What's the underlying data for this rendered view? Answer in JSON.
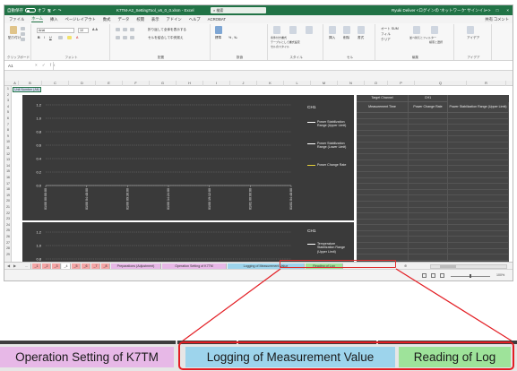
{
  "window": {
    "autosave_label": "自動保存",
    "autosave_state": "オフ",
    "title": "K7TM-A2_SettingTool_v6_0_0.xlsm - Excel",
    "search_placeholder": "検索",
    "user": "Ryuki Deliver <ログインの 'ネットワーク' サインイン >",
    "minimize": "—",
    "maximize": "□",
    "close": "×"
  },
  "menu": {
    "items": [
      "ファイル",
      "ホーム",
      "挿入",
      "ページレイアウト",
      "数式",
      "データ",
      "校閲",
      "表示",
      "アドイン",
      "ヘルプ",
      "ACROBAT"
    ],
    "share": "共有",
    "comments": "コメント"
  },
  "ribbon": {
    "paste": "貼り付け",
    "clipboard": "クリップボード",
    "font_name": "Arial",
    "font_size": "10",
    "font": "フォント",
    "alignment": "配置",
    "wrap": "折り返して全体を表示する",
    "merge": "セルを結合して中央揃え",
    "number_format": "標準",
    "number": "数値",
    "conditional": "条件付き書式",
    "table": "テーブルとして書式設定",
    "cell_styles": "セルのスタイル",
    "styles": "スタイル",
    "insert": "挿入",
    "delete": "削除",
    "format": "書式",
    "cells": "セル",
    "autosum": "オート SUM",
    "fill": "フィル",
    "clear": "クリア",
    "sort": "並べ替えとフィルター",
    "find": "検索と選択",
    "editing": "編集",
    "ideas": "アイデア",
    "ideas_group": "アイデア"
  },
  "formula_bar": {
    "name_box": "A1",
    "fx": "fx",
    "value": ""
  },
  "columns": [
    "A",
    "B",
    "C",
    "D",
    "E",
    "F",
    "G",
    "H",
    "I",
    "J",
    "K",
    "L",
    "M",
    "N",
    "O",
    "P",
    "Q",
    "R",
    "S"
  ],
  "rows": [
    "1",
    "2",
    "3",
    "4",
    "5",
    "6",
    "7",
    "8",
    "9",
    "10",
    "11",
    "12",
    "13",
    "14",
    "15",
    "16",
    "17",
    "18",
    "19",
    "20",
    "21",
    "22",
    "23",
    "24",
    "25",
    "26",
    "27",
    "28",
    "29"
  ],
  "unit_cell": "Unit Number (Alt)",
  "charts": [
    {
      "title": "CH1",
      "legend": [
        {
          "label": "Power Stabilization Range (Upper Limit)",
          "color": "#ffffff"
        },
        {
          "label": "Power Stabilization Range (Lower Limit)",
          "color": "#ffffff"
        },
        {
          "label": "Power Change Rate",
          "color": "#e6d23a"
        }
      ]
    },
    {
      "title": "CH1",
      "legend": [
        {
          "label": "Temperature Stabilization Range (Upper Limit)",
          "color": "#ffffff"
        }
      ]
    }
  ],
  "chart_data": [
    {
      "type": "line",
      "title": "CH1",
      "ylim": [
        0,
        1.2
      ],
      "y_ticks": [
        "1.2",
        "1.0",
        "0.8",
        "0.6",
        "0.4",
        "0.2",
        "0.0"
      ],
      "x_ticks": [
        "01/00 00:00:00",
        "01/00 04:48:00",
        "01/00 09:36:00",
        "01/00 14:24:00",
        "01/00 19:12:00",
        "01/01 00:00:00",
        "01/01 04:48:00"
      ],
      "grid": true,
      "legend_position": "right",
      "series": [
        {
          "name": "Power Stabilization Range (Upper Limit)",
          "values": []
        },
        {
          "name": "Power Stabilization Range (Lower Limit)",
          "values": []
        },
        {
          "name": "Power Change Rate",
          "values": []
        }
      ]
    },
    {
      "type": "line",
      "title": "CH1",
      "ylim": [
        0,
        1.2
      ],
      "y_ticks": [
        "1.2",
        "1.0",
        "0.8"
      ],
      "grid": true,
      "legend_position": "right",
      "series": [
        {
          "name": "Temperature Stabilization Range (Upper Limit)",
          "values": []
        }
      ]
    }
  ],
  "data_table": {
    "target_channel_label": "Target Channel",
    "target_channel_value": "CH1",
    "headers": [
      "Measurement Time",
      "Power Change Rate",
      "Power Stabilization Range (Upper Limit)"
    ]
  },
  "sheet_tabs": {
    "tabs": [
      {
        "label": "...",
        "color": "#f0f0f0"
      },
      {
        "label": "_1",
        "color": "#f4a6a6"
      },
      {
        "label": "_2",
        "color": "#f4a6a6"
      },
      {
        "label": "_3",
        "color": "#f4a6a6"
      },
      {
        "label": "_4",
        "color": "#ffffff"
      },
      {
        "label": "_5",
        "color": "#f4a6a6"
      },
      {
        "label": "_6",
        "color": "#f4a6a6"
      },
      {
        "label": "_7",
        "color": "#f4a6a6"
      },
      {
        "label": "_8",
        "color": "#f4a6a6"
      },
      {
        "label": "Preparations (Adjustment)",
        "color": "#e7b8e7"
      },
      {
        "label": "Operation Setting of K7TM",
        "color": "#e7b8e7"
      },
      {
        "label": "Logging of Measurement Value",
        "color": "#9dd4ec"
      },
      {
        "label": "Reading of Log",
        "color": "#9ee39a"
      }
    ],
    "add_sheet": "⊕"
  },
  "status": {
    "zoom": "100%"
  },
  "zoom_tabs": {
    "operation": "Operation Setting of K7TM",
    "logging": "Logging of Measurement Value",
    "reading": "Reading of Log"
  },
  "colors": {
    "excel_green": "#217346",
    "highlight_red": "#e31e24",
    "tab_pink": "#e7b8e7",
    "tab_blue": "#9dd4ec",
    "tab_green": "#9ee39a"
  }
}
